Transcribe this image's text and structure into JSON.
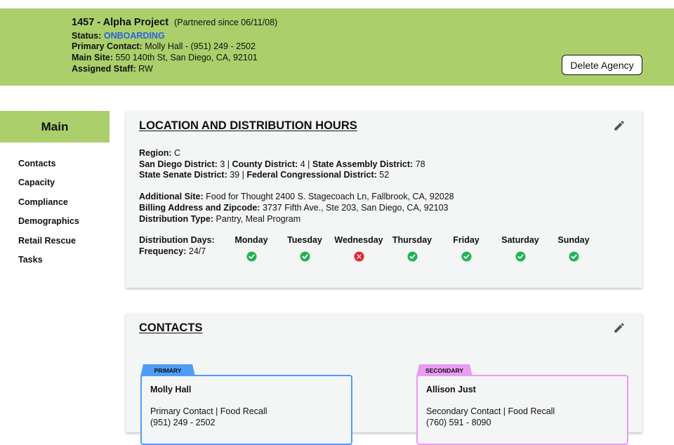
{
  "header": {
    "agency_id_name": "1457 - Alpha Project",
    "partnered_since": "(Partnered since 06/11/08)",
    "status_label": "Status:",
    "status_value": "ONBOARDING",
    "primary_contact_label": "Primary Contact:",
    "primary_contact_value": "Molly Hall - (951) 249 - 2502",
    "main_site_label": "Main Site:",
    "main_site_value": "550 140th St, San Diego, CA, 92101",
    "assigned_staff_label": "Assigned Staff:",
    "assigned_staff_value": "RW",
    "delete_button": "Delete Agency"
  },
  "sidebar": {
    "main_label": "Main",
    "items": [
      {
        "label": "Contacts"
      },
      {
        "label": "Capacity"
      },
      {
        "label": "Compliance"
      },
      {
        "label": "Demographics"
      },
      {
        "label": "Retail Rescue"
      },
      {
        "label": "Tasks"
      }
    ]
  },
  "location": {
    "title": "LOCATION AND DISTRIBUTION HOURS",
    "edit_icon": "pencil-icon",
    "region_label": "Region:",
    "region_value": "C",
    "sd_district_label": "San Diego District:",
    "sd_district_value": "3",
    "county_district_label": "County District:",
    "county_district_value": "4",
    "assembly_district_label": "State Assembly District:",
    "assembly_district_value": "78",
    "senate_district_label": "State Senate District:",
    "senate_district_value": "39",
    "congressional_district_label": "Federal Congressional District:",
    "congressional_district_value": "52",
    "additional_site_label": "Additional Site:",
    "additional_site_value": "Food for Thought 2400 S. Stagecoach Ln, Fallbrook, CA, 92028",
    "billing_label": "Billing Address and Zipcode:",
    "billing_value": "3737 Fifth Ave., Ste 203, San Diego, CA, 92103",
    "dist_type_label": "Distribution Type:",
    "dist_type_value": "Pantry, Meal Program",
    "dist_days_label": "Distribution Days:",
    "frequency_label": "Frequency:",
    "frequency_value": "24/7",
    "days": [
      {
        "name": "Monday",
        "open": true
      },
      {
        "name": "Tuesday",
        "open": true
      },
      {
        "name": "Wednesday",
        "open": false
      },
      {
        "name": "Thursday",
        "open": true
      },
      {
        "name": "Friday",
        "open": true
      },
      {
        "name": "Saturday",
        "open": true
      },
      {
        "name": "Sunday",
        "open": true
      }
    ]
  },
  "contacts": {
    "title": "CONTACTS",
    "edit_icon": "pencil-icon",
    "cards": [
      {
        "tag": "PRIMARY",
        "name": "Molly Hall",
        "role": "Primary Contact | Food Recall",
        "phone": "(951) 249 - 2502",
        "color": "#4f9cf7"
      },
      {
        "tag": "SECONDARY",
        "name": "Allison Just",
        "role": "Secondary Contact | Food Recall",
        "phone": "(760) 591 - 8090",
        "color": "#ea9bf2"
      }
    ]
  },
  "colors": {
    "header_green": "#aacf6b",
    "status_blue": "#2a62e0",
    "check_green": "#22b455",
    "cross_red": "#e8242e",
    "primary_blue": "#4f9cf7",
    "secondary_pink": "#ea9bf2"
  }
}
